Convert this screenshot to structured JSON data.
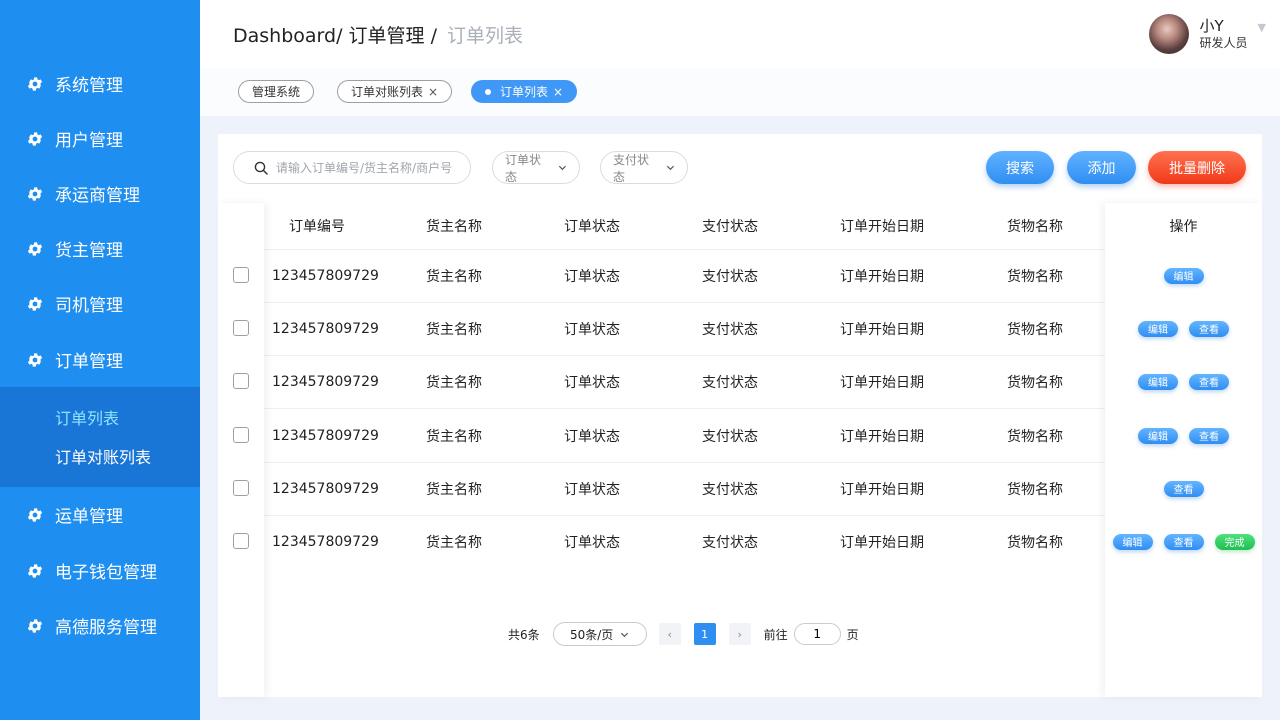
{
  "sidebar": {
    "items": [
      {
        "label": "系统管理",
        "icon": "gear-icon"
      },
      {
        "label": "用户管理",
        "icon": "gear-icon"
      },
      {
        "label": "承运商管理",
        "icon": "gear-icon"
      },
      {
        "label": "货主管理",
        "icon": "gear-icon"
      },
      {
        "label": "司机管理",
        "icon": "gear-icon"
      },
      {
        "label": "订单管理",
        "icon": "gear-icon",
        "expanded": true
      },
      {
        "label": "运单管理",
        "icon": "gear-icon"
      },
      {
        "label": "电子钱包管理",
        "icon": "gear-icon"
      },
      {
        "label": "高德服务管理",
        "icon": "gear-icon"
      }
    ],
    "submenu": [
      {
        "label": "订单列表",
        "active": true
      },
      {
        "label": "订单对账列表",
        "active": false
      }
    ],
    "colors": {
      "background": "#1e8ef0",
      "submenu_bg": "#1975d6",
      "active_text": "#8fe3ff"
    }
  },
  "header": {
    "breadcrumb": [
      "Dashboard/",
      "订单管理",
      "/",
      "订单列表"
    ],
    "user": {
      "name": "小Y",
      "role": "研发人员",
      "caret": "▼"
    }
  },
  "tags": [
    {
      "label": "管理系统",
      "closable": false,
      "active": false
    },
    {
      "label": "订单对账列表",
      "closable": true,
      "active": false
    },
    {
      "label": "订单列表",
      "closable": true,
      "active": true
    }
  ],
  "toolbar": {
    "search_placeholder": "请输入订单编号/货主名称/商户号",
    "order_status_label": "订单状态",
    "pay_status_label": "支付状态",
    "search_label": "搜索",
    "add_label": "添加",
    "batch_delete_label": "批量删除"
  },
  "table": {
    "columns": [
      "订单编号",
      "货主名称",
      "订单状态",
      "支付状态",
      "订单开始日期",
      "货物名称",
      "操作"
    ],
    "rows": [
      {
        "cells": [
          "123457809729",
          "货主名称",
          "订单状态",
          "支付状态",
          "订单开始日期",
          "货物名称"
        ],
        "ops": [
          "edit"
        ]
      },
      {
        "cells": [
          "123457809729",
          "货主名称",
          "订单状态",
          "支付状态",
          "订单开始日期",
          "货物名称"
        ],
        "ops": [
          "edit",
          "view"
        ]
      },
      {
        "cells": [
          "123457809729",
          "货主名称",
          "订单状态",
          "支付状态",
          "订单开始日期",
          "货物名称"
        ],
        "ops": [
          "edit",
          "view"
        ]
      },
      {
        "cells": [
          "123457809729",
          "货主名称",
          "订单状态",
          "支付状态",
          "订单开始日期",
          "货物名称"
        ],
        "ops": [
          "edit",
          "view"
        ]
      },
      {
        "cells": [
          "123457809729",
          "货主名称",
          "订单状态",
          "支付状态",
          "订单开始日期",
          "货物名称"
        ],
        "ops": [
          "view"
        ]
      },
      {
        "cells": [
          "123457809729",
          "货主名称",
          "订单状态",
          "支付状态",
          "订单开始日期",
          "货物名称"
        ],
        "ops": [
          "edit",
          "view",
          "done"
        ]
      }
    ],
    "op_labels": {
      "edit": "编辑",
      "view": "查看",
      "done": "完成"
    }
  },
  "pagination": {
    "total": "共6条",
    "per_page": "50条/页",
    "prev": "‹",
    "current_page": "1",
    "next": "›",
    "goto_label": "前往",
    "goto_value": "1",
    "page_suffix": "页"
  }
}
